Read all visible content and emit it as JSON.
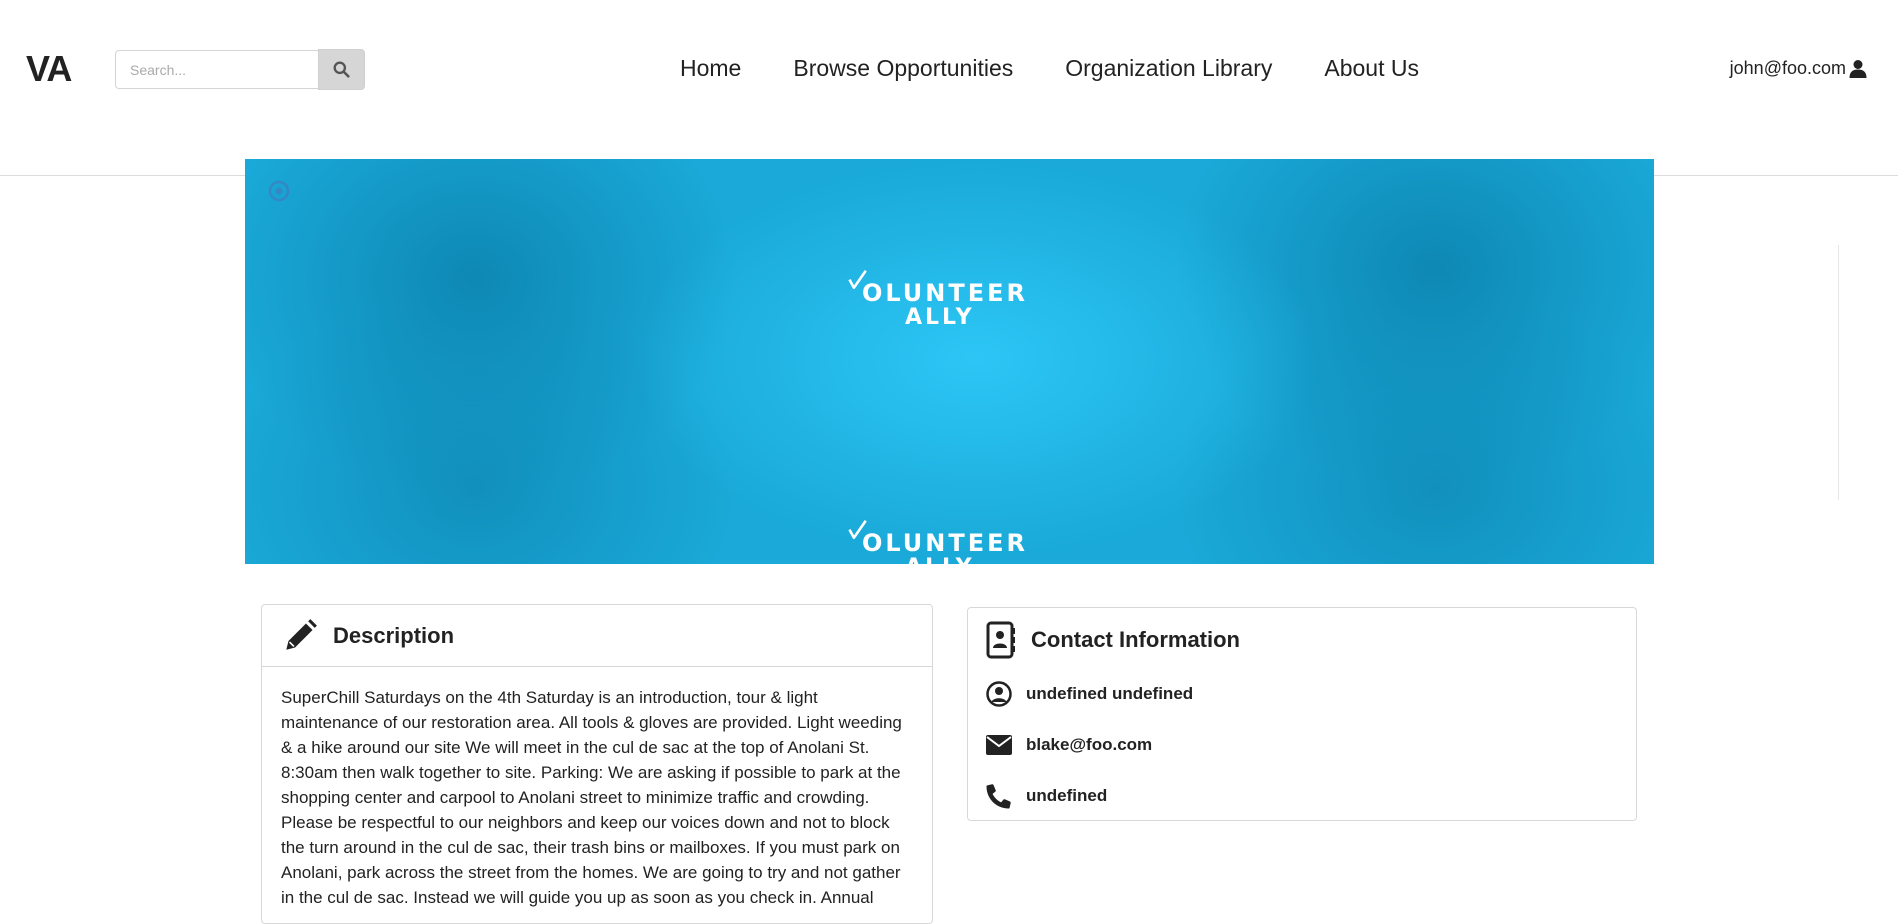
{
  "header": {
    "logo": "VA",
    "search": {
      "placeholder": "Search..."
    },
    "nav": [
      "Home",
      "Browse Opportunities",
      "Organization Library",
      "About Us"
    ],
    "user_email": "john@foo.com"
  },
  "banner": {
    "logo_line1": "OLUNTEER",
    "logo_line2": "ALLY"
  },
  "description": {
    "title": "Description",
    "text": "SuperChill Saturdays on the 4th Saturday is an introduction, tour & light maintenance of our restoration area. All tools & gloves are provided. Light weeding & a hike around our site We will meet in the cul de sac at the top of Anolani St. 8:30am then walk together to site. Parking: We are asking if possible to park at the shopping center and carpool to Anolani street to minimize traffic and crowding. Please be respectful to our neighbors and keep our voices down and not to block the turn around in the cul de sac, their trash bins or mailboxes. If you must park on Anolani, park across the street from the homes. We are going to try and not gather in the cul de sac. Instead we will guide you up as soon as you check in. Annual"
  },
  "contact": {
    "title": "Contact Information",
    "name": "undefined undefined",
    "email": "blake@foo.com",
    "phone": "undefined"
  },
  "colors": {
    "banner_base": "#1aa9d8",
    "banner_highlight": "#2cc6f5",
    "text": "#222222",
    "search_button": "#d6d6d6"
  }
}
